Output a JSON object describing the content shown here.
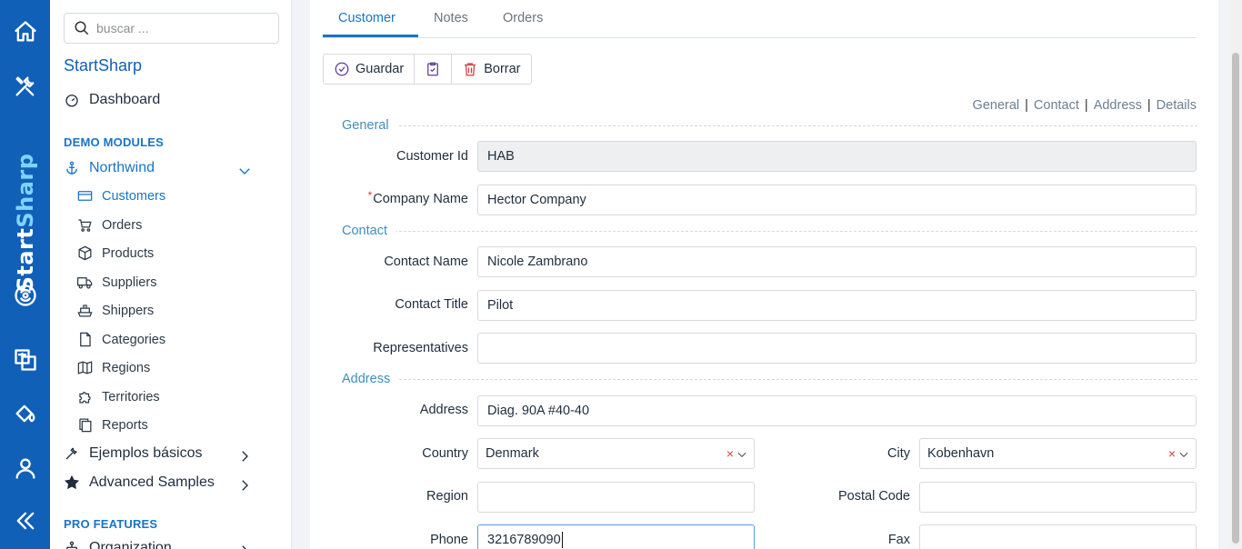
{
  "rail": {
    "brand_start": "Start",
    "brand_end": "Sharp",
    "icons": [
      "home-icon",
      "tools-icon",
      "translate-icon",
      "paint-bucket-icon",
      "user-icon",
      "collapse-icon"
    ]
  },
  "sidebar": {
    "search_placeholder": "buscar ...",
    "app_title": "StartSharp",
    "dashboard": "Dashboard",
    "demo_modules": "DEMO MODULES",
    "northwind": "Northwind",
    "items": [
      {
        "label": "Customers",
        "icon": "card-icon",
        "active": true
      },
      {
        "label": "Orders",
        "icon": "cart-icon"
      },
      {
        "label": "Products",
        "icon": "box-icon"
      },
      {
        "label": "Suppliers",
        "icon": "truck-icon"
      },
      {
        "label": "Shippers",
        "icon": "ship-icon"
      },
      {
        "label": "Categories",
        "icon": "page-icon"
      },
      {
        "label": "Regions",
        "icon": "map-icon"
      },
      {
        "label": "Territories",
        "icon": "puzzle-icon"
      },
      {
        "label": "Reports",
        "icon": "copy-icon"
      }
    ],
    "basic_samples": "Ejemplos básicos",
    "advanced_samples": "Advanced Samples",
    "pro_features": "PRO FEATURES",
    "organization": "Organization"
  },
  "tabs": [
    {
      "label": "Customer",
      "active": true
    },
    {
      "label": "Notes"
    },
    {
      "label": "Orders"
    }
  ],
  "toolbar": {
    "save": "Guardar",
    "delete": "Borrar"
  },
  "category_links": [
    "General",
    "Contact",
    "Address",
    "Details"
  ],
  "form": {
    "general_title": "General",
    "contact_title": "Contact",
    "address_title": "Address",
    "customer_id_label": "Customer Id",
    "customer_id_value": "HAB",
    "company_name_label": "Company Name",
    "company_name_value": "Hector Company",
    "required_mark": "*",
    "contact_name_label": "Contact Name",
    "contact_name_value": "Nicole Zambrano",
    "contact_title_label": "Contact Title",
    "contact_title_value": "Pilot",
    "representatives_label": "Representatives",
    "representatives_value": "",
    "address_label": "Address",
    "address_value": "Diag. 90A #40-40",
    "country_label": "Country",
    "country_value": "Denmark",
    "city_label": "City",
    "city_value": "Kobenhavn",
    "region_label": "Region",
    "region_value": "",
    "postal_code_label": "Postal Code",
    "postal_code_value": "",
    "phone_label": "Phone",
    "phone_value": "3216789090",
    "fax_label": "Fax",
    "fax_value": "",
    "clear_glyph": "×"
  }
}
